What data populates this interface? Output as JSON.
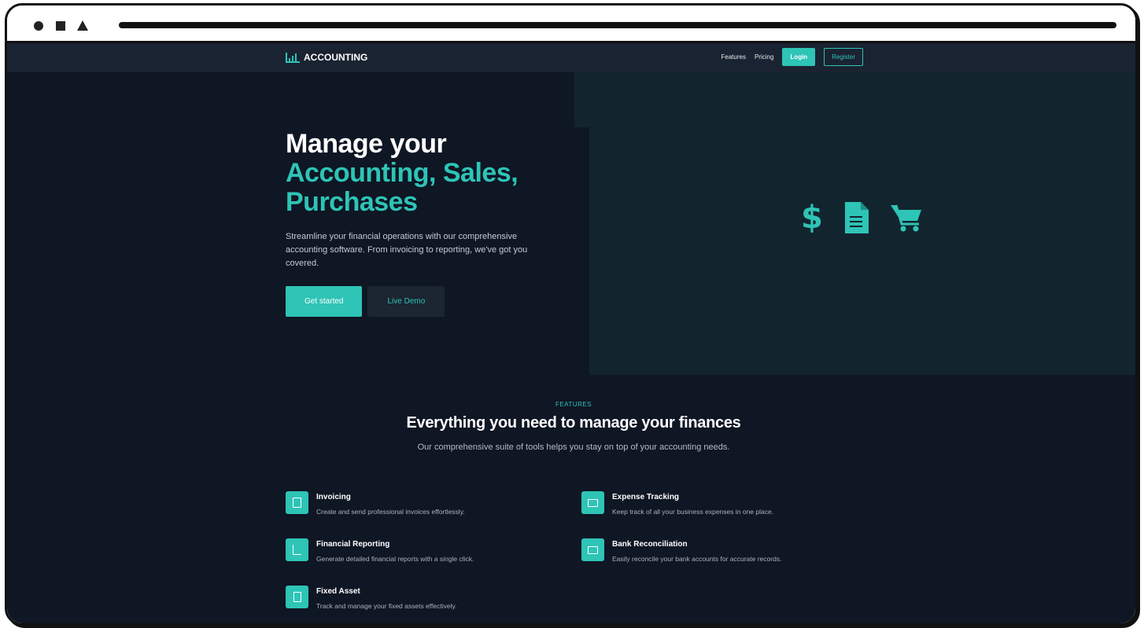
{
  "brand": {
    "name": "ACCOUNTING",
    "icon": "bar-chart-icon"
  },
  "nav": {
    "features": "Features",
    "pricing": "Pricing",
    "login": "Login",
    "register": "Register"
  },
  "hero": {
    "title_line1": "Manage your",
    "title_line2": "Accounting, Sales,",
    "title_line3": "Purchases",
    "description": "Streamline your financial operations with our comprehensive accounting software. From invoicing to reporting, we've got you covered.",
    "primary_button": "Get started",
    "secondary_button": "Live Demo",
    "icons": [
      "dollar-icon",
      "document-icon",
      "cart-icon"
    ]
  },
  "features": {
    "kicker": "FEATURES",
    "title": "Everything you need to manage your finances",
    "subtitle": "Our comprehensive suite of tools helps you stay on top of your accounting needs.",
    "items": [
      {
        "title": "Invoicing",
        "description": "Create and send professional invoices effortlessly.",
        "icon": "invoice-icon"
      },
      {
        "title": "Expense Tracking",
        "description": "Keep track of all your business expenses in one place.",
        "icon": "credit-card-icon"
      },
      {
        "title": "Financial Reporting",
        "description": "Generate detailed financial reports with a single click.",
        "icon": "chart-icon"
      },
      {
        "title": "Bank Reconciliation",
        "description": "Easily reconcile your bank accounts for accurate records.",
        "icon": "bank-card-icon"
      },
      {
        "title": "Fixed Asset",
        "description": "Track and manage your fixed assets effectively.",
        "icon": "building-icon"
      }
    ]
  },
  "colors": {
    "accent": "#2ec4b6",
    "background": "#0f1624",
    "nav": "#1a2331",
    "hero_panel": "#12252f"
  }
}
